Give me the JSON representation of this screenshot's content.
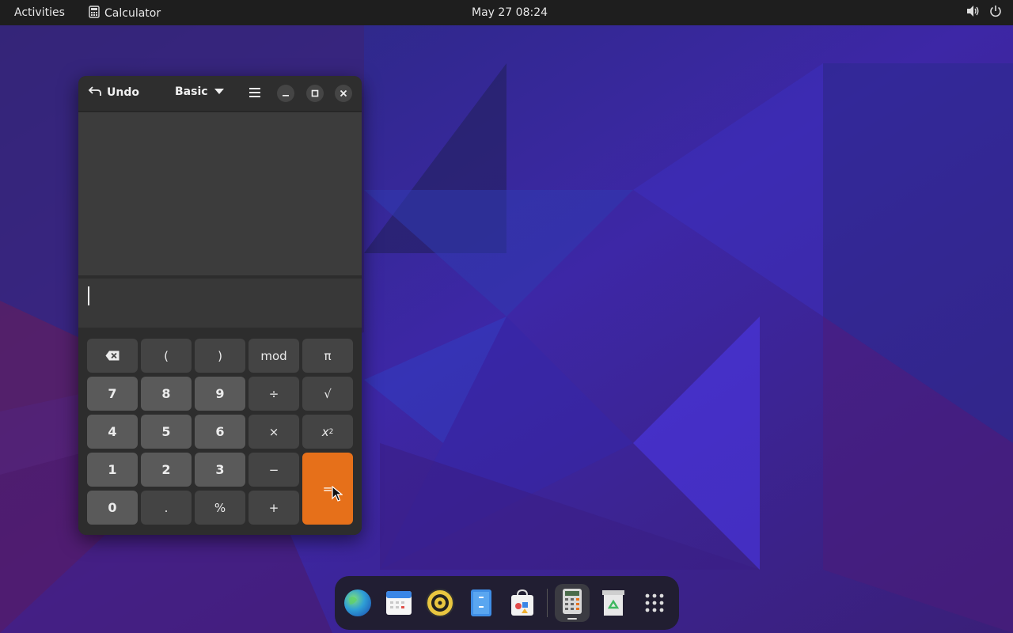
{
  "topbar": {
    "activities": "Activities",
    "app_name": "Calculator",
    "clock": "May 27  08:24"
  },
  "window": {
    "undo_label": "Undo",
    "mode_label": "Basic",
    "entry_value": ""
  },
  "keypad": {
    "row1": [
      "(",
      ")",
      "mod",
      "π"
    ],
    "row2": [
      "7",
      "8",
      "9",
      "÷",
      "√"
    ],
    "row3": [
      "4",
      "5",
      "6",
      "×"
    ],
    "square_base": "x",
    "square_exp": "2",
    "row4": [
      "1",
      "2",
      "3",
      "−"
    ],
    "row5": [
      "0",
      ".",
      "%",
      "+"
    ],
    "equals": "="
  },
  "colors": {
    "accent": "#e6701a",
    "topbar": "#1e1e1e",
    "window_bg": "#2d2d2d"
  },
  "dock": {
    "items": [
      "web-browser-icon",
      "calendar-icon",
      "music-player-icon",
      "file-manager-icon",
      "software-store-icon",
      "calculator-icon",
      "trash-icon",
      "app-grid-icon"
    ]
  }
}
